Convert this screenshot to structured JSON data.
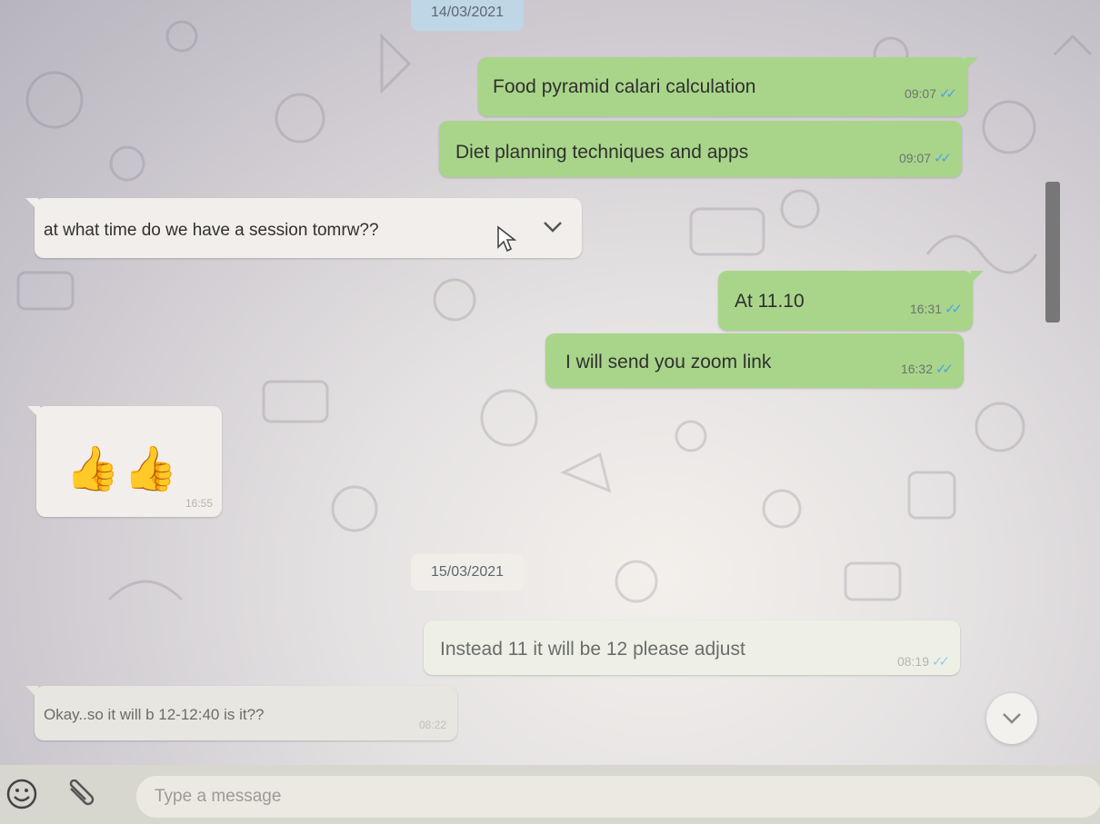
{
  "dates": [
    "14/03/2021",
    "15/03/2021"
  ],
  "messages": [
    {
      "text": "Food pyramid calari calculation",
      "time": "09:07",
      "direction": "outgoing",
      "status": "read"
    },
    {
      "text": "Diet planning techniques and apps",
      "time": "09:07",
      "direction": "outgoing",
      "status": "read"
    },
    {
      "text": "at what time do we have a session tomrw??",
      "direction": "incoming"
    },
    {
      "text": "At 11.10",
      "time": "16:31",
      "direction": "outgoing",
      "status": "read"
    },
    {
      "text": "I will send you zoom link",
      "time": "16:32",
      "direction": "outgoing",
      "status": "read"
    },
    {
      "text": "👍👍",
      "time": "16:55",
      "direction": "incoming"
    },
    {
      "text": "Instead 11 it will be 12 please adjust",
      "time": "08:19",
      "direction": "outgoing",
      "status": "read"
    },
    {
      "text": "Okay..so it will b 12-12:40 is it??",
      "time": "08:22",
      "direction": "incoming"
    }
  ],
  "composer": {
    "placeholder": "Type a message"
  },
  "icons": {
    "emoji": "emoji-icon",
    "attach": "paperclip-icon",
    "message_menu": "chevron-down-icon",
    "scroll_down": "chevron-down-icon",
    "read_receipt": "double-check-icon"
  },
  "colors": {
    "outgoing_bubble": "#a9d58a",
    "incoming_bubble": "#f1eeeb",
    "read_tick": "#4aa3e6"
  }
}
